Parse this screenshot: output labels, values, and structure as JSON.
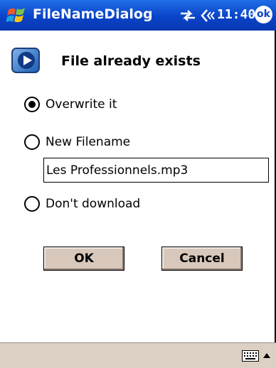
{
  "titlebar": {
    "app_title": "FileNameDialog",
    "clock": "11:40",
    "ok_label": "ok",
    "icons": [
      "windows-start-flag-icon",
      "connectivity-icon",
      "volume-icon"
    ]
  },
  "dialog": {
    "icon": "media-player-icon",
    "heading": "File already exists",
    "options": [
      {
        "label": "Overwrite it",
        "selected": true
      },
      {
        "label": "New Filename",
        "selected": false
      },
      {
        "label": "Don't download",
        "selected": false
      }
    ],
    "filename_value": "Les Professionnels.mp3",
    "ok_button": "OK",
    "cancel_button": "Cancel"
  },
  "bottombar": {
    "icons": [
      "keyboard-icon",
      "sip-arrow-up-icon"
    ]
  },
  "colors": {
    "titlebar": "#0a43c9",
    "button_face": "#d8c8bc",
    "bottombar": "#dcd0c4"
  }
}
